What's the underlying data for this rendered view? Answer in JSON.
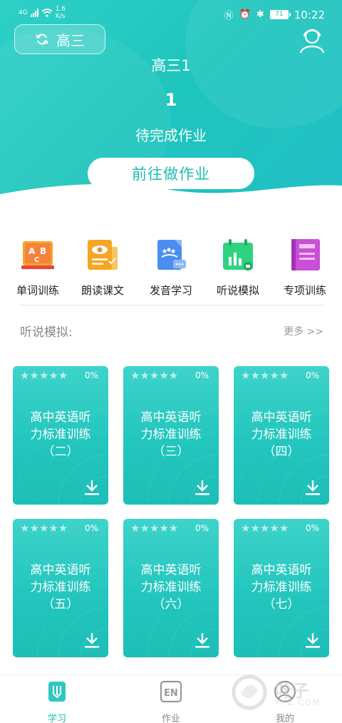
{
  "status_bar": {
    "network": "4G",
    "speed_value": "1.6",
    "speed_unit": "K/s",
    "battery": "71",
    "time": "10:22"
  },
  "header": {
    "grade_switch_label": "高三",
    "class_name": "高三1",
    "pending_count": "1",
    "pending_label": "待完成作业",
    "go_button": "前往做作业"
  },
  "categories": [
    {
      "label": "单词训练",
      "icon": "abc-board-icon"
    },
    {
      "label": "朗读课文",
      "icon": "reading-eye-icon"
    },
    {
      "label": "发音学习",
      "icon": "pronunciation-icon"
    },
    {
      "label": "听说模拟",
      "icon": "listening-chart-icon"
    },
    {
      "label": "专项训练",
      "icon": "special-book-icon"
    }
  ],
  "section": {
    "title": "听说模拟:",
    "more": "更多 >>"
  },
  "cards": [
    {
      "line1": "高中英语听",
      "line2": "力标准训练",
      "line3": "（二）",
      "progress": "0%",
      "stars": "★★★★★",
      "rating": 0
    },
    {
      "line1": "高中英语听",
      "line2": "力标准训练",
      "line3": "（三）",
      "progress": "0%",
      "stars": "★★★★★",
      "rating": 0
    },
    {
      "line1": "高中英语听",
      "line2": "力标准训练",
      "line3": "（四）",
      "progress": "0%",
      "stars": "★★★★★",
      "rating": 0
    },
    {
      "line1": "高中英语听",
      "line2": "力标准训练",
      "line3": "（五）",
      "progress": "0%",
      "stars": "★★★★★",
      "rating": 0
    },
    {
      "line1": "高中英语听",
      "line2": "力标准训练",
      "line3": "（六）",
      "progress": "0%",
      "stars": "★★★★★",
      "rating": 0
    },
    {
      "line1": "高中英语听",
      "line2": "力标准训练",
      "line3": "（七）",
      "progress": "0%",
      "stars": "★★★★★",
      "rating": 0
    }
  ],
  "tabs": [
    {
      "label": "学习",
      "active": true
    },
    {
      "label": "作业",
      "active": false,
      "icon_text": "EN"
    },
    {
      "label": "我的",
      "active": false
    }
  ],
  "watermark": {
    "text": "叶子",
    "sub": "YYZ.COM"
  },
  "colors": {
    "brand": "#1ec5bd",
    "accent_text": "#1cbcb4"
  }
}
